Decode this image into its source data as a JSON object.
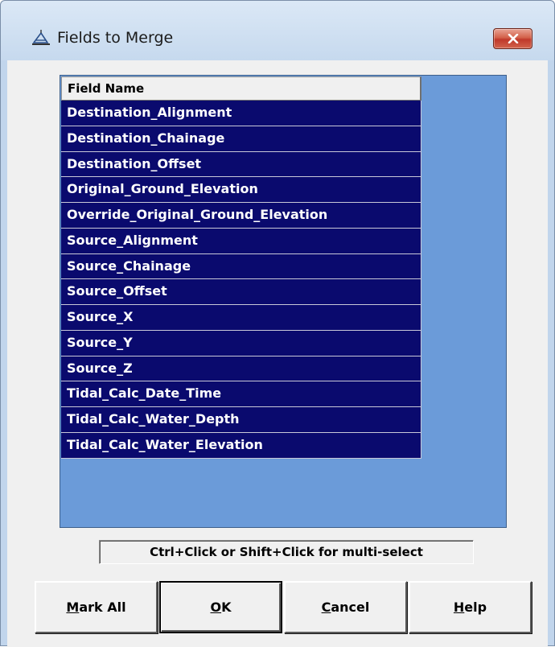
{
  "window": {
    "title": "Fields to Merge",
    "title_icon": "app-icon",
    "close_icon": "close-icon",
    "accent_close": "#c0392b"
  },
  "list": {
    "header": "Field Name",
    "items": [
      "Destination_Alignment",
      "Destination_Chainage",
      "Destination_Offset",
      "Original_Ground_Elevation",
      "Override_Original_Ground_Elevation",
      "Source_Alignment",
      "Source_Chainage",
      "Source_Offset",
      "Source_X",
      "Source_Y",
      "Source_Z",
      "Tidal_Calc_Date_Time",
      "Tidal_Calc_Water_Depth",
      "Tidal_Calc_Water_Elevation"
    ],
    "selected_color": "#0a0a6e",
    "background_color": "#6b9bd9"
  },
  "hint": "Ctrl+Click or Shift+Click for multi-select",
  "buttons": {
    "mark_all": {
      "accel": "M",
      "rest": "ark All"
    },
    "ok": {
      "accel": "O",
      "rest": "K"
    },
    "cancel": {
      "accel": "C",
      "rest": "ancel"
    },
    "help": {
      "accel": "H",
      "rest": "elp"
    }
  }
}
